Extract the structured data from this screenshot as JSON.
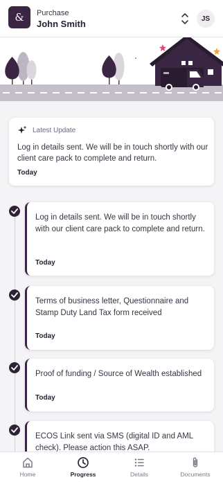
{
  "header": {
    "logo_text": "&",
    "subtitle": "Purchase",
    "name": "John Smith",
    "avatar_initials": "JS"
  },
  "latest_update": {
    "label": "Latest Update",
    "text": "Log in details sent. We will be in touch shortly with our client care pack to complete and return.",
    "date": "Today"
  },
  "timeline": [
    {
      "text": "Log in details sent. We will be in touch shortly with our client care pack to complete and return.",
      "date": "Today"
    },
    {
      "text": "Terms of business letter, Questionnaire and Stamp Duty Land Tax form received",
      "date": "Today"
    },
    {
      "text": "Proof of funding / Source of Wealth established",
      "date": "Today"
    },
    {
      "text": "ECOS Link sent via SMS (digital ID and AML check). Please action this ASAP.",
      "date": ""
    }
  ],
  "nav": [
    {
      "label": "Home",
      "icon": "home-icon"
    },
    {
      "label": "Progress",
      "icon": "progress-icon",
      "active": true
    },
    {
      "label": "Details",
      "icon": "details-icon"
    },
    {
      "label": "Documents",
      "icon": "documents-icon"
    }
  ],
  "colors": {
    "brand": "#3a2542",
    "accent_star_pink": "#e0457b",
    "accent_star_orange": "#f2a431",
    "road": "#c4bfc8"
  }
}
